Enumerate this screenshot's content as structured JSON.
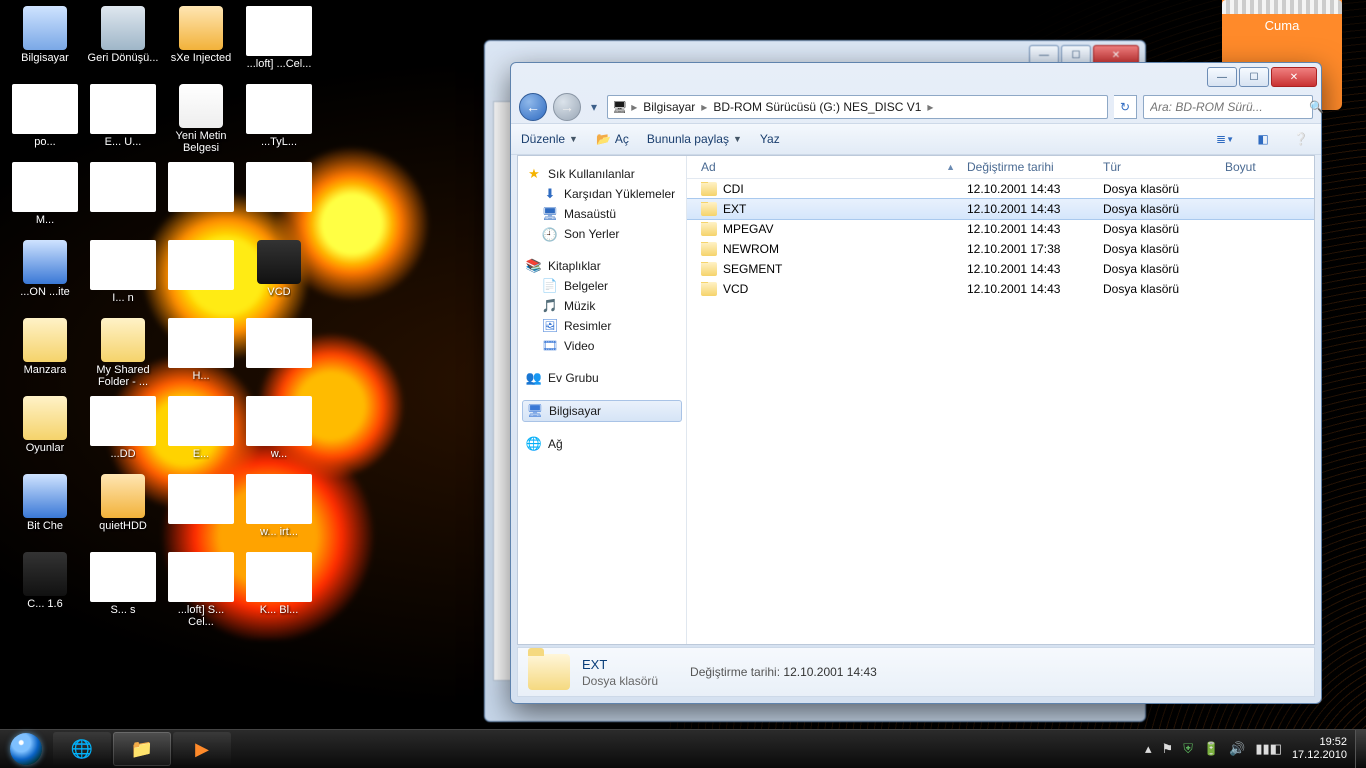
{
  "gadget": {
    "day": "Cuma"
  },
  "desktop_icons": [
    {
      "label": "Bilgisayar",
      "g": "g-computer"
    },
    {
      "label": "Geri Dönüşü...",
      "g": "g-bin"
    },
    {
      "label": "sXe Injected",
      "g": "g-app"
    },
    {
      "label": "...loft] ...Cel...",
      "g": "g-java",
      "white": true
    },
    {
      "label": "po...",
      "g": "g-doc",
      "white": true
    },
    {
      "label": "E... U...",
      "g": "g-app",
      "white": true
    },
    {
      "label": "Yeni Metin Belgesi",
      "g": "g-txt"
    },
    {
      "label": "...TyL...",
      "g": "g-rar",
      "white": true
    },
    {
      "label": "M...",
      "g": "g-doc",
      "white": true
    },
    {
      "label": "",
      "g": "g-rar",
      "white": true
    },
    {
      "label": "",
      "g": "g-blue",
      "white": true
    },
    {
      "label": "",
      "g": "g-folder",
      "white": true
    },
    {
      "label": "...ON ...ite",
      "g": "g-blue"
    },
    {
      "label": "I... n",
      "g": "g-app",
      "white": true
    },
    {
      "label": "",
      "g": "g-folder",
      "white": true
    },
    {
      "label": "VCD",
      "g": "g-dark"
    },
    {
      "label": "Manzara",
      "g": "g-folder"
    },
    {
      "label": "My Shared Folder - ...",
      "g": "g-folder"
    },
    {
      "label": "H...",
      "g": "g-folder",
      "white": true
    },
    {
      "label": "",
      "g": "g-dark",
      "white": true
    },
    {
      "label": "Oyunlar",
      "g": "g-folder"
    },
    {
      "label": "...DD",
      "g": "g-blue",
      "white": true
    },
    {
      "label": "E...",
      "g": "g-folder",
      "white": true
    },
    {
      "label": "w...",
      "g": "g-rar",
      "white": true
    },
    {
      "label": "Bit Che",
      "g": "g-blue"
    },
    {
      "label": "quietHDD",
      "g": "g-app"
    },
    {
      "label": "",
      "g": "g-txt",
      "white": true
    },
    {
      "label": "w... irt...",
      "g": "g-rar",
      "white": true
    },
    {
      "label": "C... 1.6",
      "g": "g-dark"
    },
    {
      "label": "S... s",
      "g": "g-blue",
      "white": true
    },
    {
      "label": "...loft] S... Cel...",
      "g": "g-rar",
      "white": true
    },
    {
      "label": "K... Bl...",
      "g": "g-dark",
      "white": true
    }
  ],
  "window": {
    "breadcrumb": {
      "root_icon": "🖥",
      "segments": [
        "Bilgisayar",
        "BD-ROM Sürücüsü (G:) NES_DISC V1"
      ]
    },
    "search_placeholder": "Ara: BD-ROM Sürü...",
    "toolbar": {
      "organize": "Düzenle",
      "open": "Aç",
      "share": "Bununla paylaş",
      "burn": "Yaz"
    },
    "nav": {
      "favorites": {
        "hdr": "Sık Kullanılanlar",
        "items": [
          "Karşıdan Yüklemeler",
          "Masaüstü",
          "Son Yerler"
        ]
      },
      "libraries": {
        "hdr": "Kitaplıklar",
        "items": [
          "Belgeler",
          "Müzik",
          "Resimler",
          "Video"
        ]
      },
      "homegroup": "Ev Grubu",
      "computer": "Bilgisayar",
      "network": "Ağ"
    },
    "columns": {
      "name": "Ad",
      "date": "Değiştirme tarihi",
      "type": "Tür",
      "size": "Boyut"
    },
    "rows": [
      {
        "name": "CDI",
        "date": "12.10.2001 14:43",
        "type": "Dosya klasörü"
      },
      {
        "name": "EXT",
        "date": "12.10.2001 14:43",
        "type": "Dosya klasörü",
        "selected": true
      },
      {
        "name": "MPEGAV",
        "date": "12.10.2001 14:43",
        "type": "Dosya klasörü"
      },
      {
        "name": "NEWROM",
        "date": "12.10.2001 17:38",
        "type": "Dosya klasörü"
      },
      {
        "name": "SEGMENT",
        "date": "12.10.2001 14:43",
        "type": "Dosya klasörü"
      },
      {
        "name": "VCD",
        "date": "12.10.2001 14:43",
        "type": "Dosya klasörü"
      }
    ],
    "details": {
      "name": "EXT",
      "sub": "Dosya klasörü",
      "date_label": "Değiştirme tarihi:",
      "date": "12.10.2001 14:43"
    }
  },
  "tray": {
    "time": "19:52",
    "date": "17.12.2010"
  }
}
